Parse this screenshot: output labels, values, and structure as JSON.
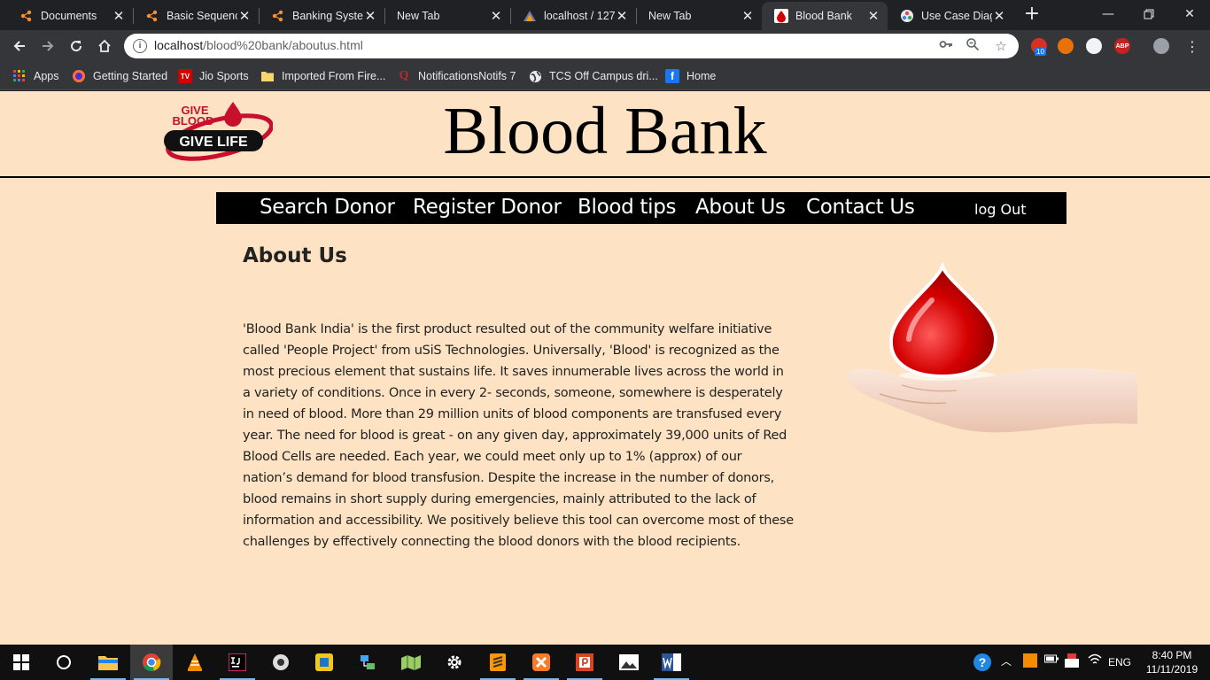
{
  "browser": {
    "tabs": [
      {
        "title": "Documents",
        "icon": "lucidchart-icon"
      },
      {
        "title": "Basic Sequenc",
        "icon": "lucidchart-icon"
      },
      {
        "title": "Banking Syster",
        "icon": "lucidchart-icon"
      },
      {
        "title": "New Tab",
        "icon": "none"
      },
      {
        "title": "localhost / 127",
        "icon": "phpmyadmin-icon"
      },
      {
        "title": "New Tab",
        "icon": "none"
      },
      {
        "title": "Blood Bank",
        "icon": "blood-bank-icon",
        "active": true
      },
      {
        "title": "Use Case Diag",
        "icon": "diagram-icon"
      }
    ],
    "address": {
      "host": "localhost",
      "path": "/blood%20bank/aboutus.html"
    },
    "extension_badge": "10",
    "adblock_label": "ABP",
    "bookmarks": [
      {
        "label": "Apps",
        "icon": "apps-grid-icon"
      },
      {
        "label": "Getting Started",
        "icon": "firefox-icon"
      },
      {
        "label": "Jio Sports",
        "icon": "tv-icon"
      },
      {
        "label": "Imported From Fire...",
        "icon": "folder-icon"
      },
      {
        "label": "NotificationsNotifs 7",
        "icon": "quora-icon"
      },
      {
        "label": "TCS Off Campus dri...",
        "icon": "globe-icon"
      },
      {
        "label": "Home",
        "icon": "facebook-icon"
      }
    ]
  },
  "page": {
    "logo": {
      "line1": "GIVE",
      "line2": "BLOOD",
      "line3": "GIVE LIFE"
    },
    "site_title": "Blood Bank",
    "nav": [
      "Search Donor",
      "Register Donor",
      "Blood tips",
      "About Us",
      "Contact Us"
    ],
    "logout": "log Out",
    "heading": "About Us",
    "body": "'Blood Bank India' is the first product resulted out of the community welfare initiative called 'People Project' from uSiS Technologies. Universally, 'Blood' is recognized as the most precious element that sustains life. It saves innumerable lives across the world in a variety of conditions. Once in every 2- seconds, someone, somewhere is desperately in need of blood. More than 29 million units of blood components are transfused every year. The need for blood is great - on any given day, approximately 39,000 units of Red Blood Cells are needed. Each year, we could meet only up to 1% (approx) of our nation’s demand for blood transfusion. Despite the increase in the number of donors, blood remains in short supply during emergencies, mainly attributed to the lack of information and accessibility. We positively believe this tool can overcome most of these challenges by effectively connecting the blood donors with the blood recipients."
  },
  "taskbar": {
    "language": "ENG",
    "time": "8:40 PM",
    "date": "11/11/2019"
  },
  "colors": {
    "page_bg": "#fde3c3",
    "nav_bg": "#000000",
    "blood_red": "#d40000"
  }
}
